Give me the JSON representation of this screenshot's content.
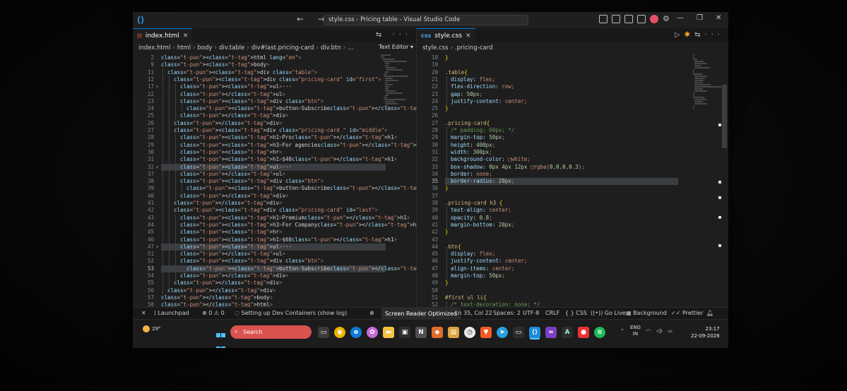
{
  "window": {
    "title": "style.css - Pricing table - Visual Studio Code",
    "nav_arrows": "← →",
    "controls": [
      "—",
      "❐",
      "✕"
    ]
  },
  "left_editor": {
    "tab": {
      "label": "index.html",
      "icon": "html-file-icon",
      "close": "✕"
    },
    "tab_actions": "⇆ ···",
    "breadcrumb": [
      "index.html",
      "html",
      "body",
      "div.table",
      "div#last.pricing-card",
      "div.btn",
      "…"
    ],
    "breadcrumb_right": "Text Editor ▾",
    "lines": [
      {
        "n": "2",
        "indent": 0,
        "code": "<html lang=\"en\">"
      },
      {
        "n": "9",
        "indent": 0,
        "code": "<body>"
      },
      {
        "n": "11",
        "indent": 1,
        "code": "<div class=\"table\">"
      },
      {
        "n": "12",
        "indent": 2,
        "code": "<div class=\"pricing-card\" id=\"first\">"
      },
      {
        "n": "17",
        "indent": 3,
        "code": "<ul>···",
        "fold": true
      },
      {
        "n": "22",
        "indent": 3,
        "code": "</ul>"
      },
      {
        "n": "23",
        "indent": 3,
        "code": "<div class=\"btn\">"
      },
      {
        "n": "24",
        "indent": 4,
        "code": "<button>Subscribe</button>"
      },
      {
        "n": "25",
        "indent": 3,
        "code": "</div>"
      },
      {
        "n": "26",
        "indent": 2,
        "code": "</div>"
      },
      {
        "n": "27",
        "indent": 2,
        "code": "<div class=\"pricing-card \" id=\"middle\">"
      },
      {
        "n": "28",
        "indent": 3,
        "code": "<h1>Pro</h1>"
      },
      {
        "n": "29",
        "indent": 3,
        "code": "<h3>For agencies</h3>"
      },
      {
        "n": "30",
        "indent": 3,
        "code": "<hr>"
      },
      {
        "n": "31",
        "indent": 3,
        "code": "<h1>$40</h1>"
      },
      {
        "n": "32",
        "indent": 3,
        "code": "<ul>···",
        "fold": true,
        "hl": true
      },
      {
        "n": "37",
        "indent": 3,
        "code": "</ul>"
      },
      {
        "n": "38",
        "indent": 3,
        "code": "<div class=\"btn\">"
      },
      {
        "n": "39",
        "indent": 4,
        "code": "<button>Subscribe</button>"
      },
      {
        "n": "40",
        "indent": 3,
        "code": "</div>"
      },
      {
        "n": "41",
        "indent": 2,
        "code": "</div>"
      },
      {
        "n": "42",
        "indent": 2,
        "code": "<div class=\"pricing-card\" id=\"last\">"
      },
      {
        "n": "43",
        "indent": 3,
        "code": "<h1>Premium</h1>"
      },
      {
        "n": "44",
        "indent": 3,
        "code": "<h3>For Company</h3>"
      },
      {
        "n": "45",
        "indent": 3,
        "code": "<hr>"
      },
      {
        "n": "46",
        "indent": 3,
        "code": "<h1>$60</h1>"
      },
      {
        "n": "47",
        "indent": 3,
        "code": "<ul>···",
        "fold": true,
        "hl": true
      },
      {
        "n": "51",
        "indent": 3,
        "code": "</ul>"
      },
      {
        "n": "52",
        "indent": 3,
        "code": "<div class=\"btn\">"
      },
      {
        "n": "53",
        "indent": 4,
        "code": "<button>Subscribe</button>",
        "hl": true,
        "cur": true
      },
      {
        "n": "54",
        "indent": 3,
        "code": "</div>"
      },
      {
        "n": "55",
        "indent": 2,
        "code": "</div>"
      },
      {
        "n": "56",
        "indent": 1,
        "code": "</div>"
      },
      {
        "n": "57",
        "indent": 0,
        "code": "</body>"
      },
      {
        "n": "58",
        "indent": 0,
        "code": "</html>"
      }
    ]
  },
  "right_editor": {
    "tab": {
      "label": "style.css",
      "icon": "css-file-icon",
      "close": "✕"
    },
    "breadcrumb": [
      "style.css",
      ".pricing-card"
    ],
    "lines": [
      {
        "n": "18",
        "indent": 0,
        "code": "}"
      },
      {
        "n": "19",
        "indent": 0,
        "code": ""
      },
      {
        "n": "20",
        "indent": 0,
        "code": ".table{"
      },
      {
        "n": "21",
        "indent": 1,
        "code": "display: flex;"
      },
      {
        "n": "22",
        "indent": 1,
        "code": "flex-direction: row;"
      },
      {
        "n": "23",
        "indent": 1,
        "code": "gap: 50px;"
      },
      {
        "n": "24",
        "indent": 1,
        "code": "justify-content: center;"
      },
      {
        "n": "25",
        "indent": 0,
        "code": "}"
      },
      {
        "n": "26",
        "indent": 0,
        "code": ""
      },
      {
        "n": "27",
        "indent": 0,
        "code": ".pricing-card{"
      },
      {
        "n": "28",
        "indent": 1,
        "code": "/* padding: 60px; */"
      },
      {
        "n": "29",
        "indent": 1,
        "code": "margin-top: 50px;"
      },
      {
        "n": "30",
        "indent": 1,
        "code": "height: 400px;"
      },
      {
        "n": "31",
        "indent": 1,
        "code": "width: 300px;"
      },
      {
        "n": "32",
        "indent": 1,
        "code": "background-color: □white;"
      },
      {
        "n": "33",
        "indent": 1,
        "code": "box-shadow: 0px 4px 12px □rgba(0,0,0,0.3);"
      },
      {
        "n": "34",
        "indent": 1,
        "code": "border: none;"
      },
      {
        "n": "35",
        "indent": 1,
        "code": "border-radius: 20px;",
        "hl": true,
        "cur": true
      },
      {
        "n": "36",
        "indent": 0,
        "code": "}"
      },
      {
        "n": "37",
        "indent": 0,
        "code": ""
      },
      {
        "n": "38",
        "indent": 0,
        "code": ".pricing-card h3 {"
      },
      {
        "n": "39",
        "indent": 1,
        "code": "text-align: center;"
      },
      {
        "n": "40",
        "indent": 1,
        "code": "opacity: 0.8;"
      },
      {
        "n": "41",
        "indent": 1,
        "code": "margin-bottom: 20px;"
      },
      {
        "n": "42",
        "indent": 0,
        "code": "}"
      },
      {
        "n": "43",
        "indent": 0,
        "code": ""
      },
      {
        "n": "44",
        "indent": 0,
        "code": ".btn{"
      },
      {
        "n": "45",
        "indent": 1,
        "code": "display: flex;"
      },
      {
        "n": "46",
        "indent": 1,
        "code": "justify-content: center;"
      },
      {
        "n": "47",
        "indent": 1,
        "code": "align-items: center;"
      },
      {
        "n": "48",
        "indent": 1,
        "code": "margin-top: 50px;"
      },
      {
        "n": "49",
        "indent": 0,
        "code": "}"
      },
      {
        "n": "50",
        "indent": 0,
        "code": ""
      },
      {
        "n": "51",
        "indent": 0,
        "code": "#first ul li{"
      },
      {
        "n": "52",
        "indent": 1,
        "code": "/* text-decoration: none; */"
      }
    ]
  },
  "statusbar": {
    "remote": "✕",
    "launchpad": "Launchpad",
    "problems": "⊗ 0 ⚠ 0",
    "task": "Setting up Dev Containers (show log)",
    "screen_reader": "Screen Reader Optimized",
    "position": "Ln 35, Col 22",
    "spaces": "Spaces: 2",
    "encoding": "UTF-8",
    "eol": "CRLF",
    "language": "{ } CSS",
    "golive": "Go Live",
    "background": "Background",
    "prettier": "Prettier"
  },
  "taskbar": {
    "weather": "29°",
    "search_label": "Search",
    "lang": "ENG",
    "lang2": "IN",
    "time": "23:17",
    "date": "22-09-2026"
  }
}
